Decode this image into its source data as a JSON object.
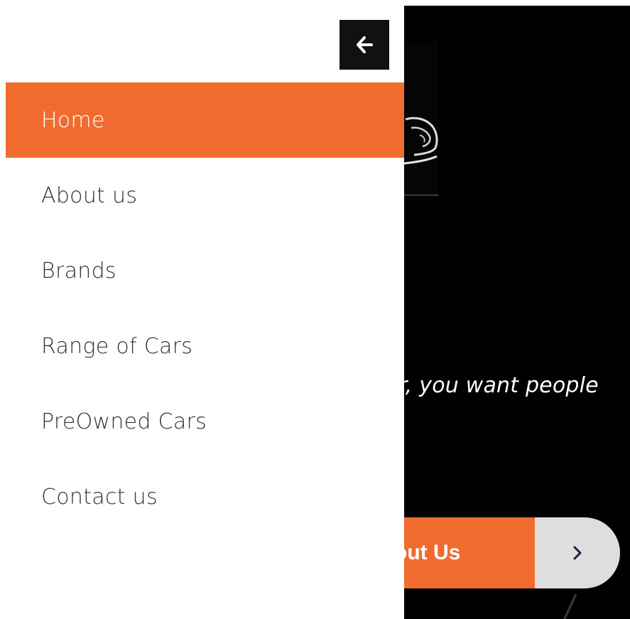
{
  "colors": {
    "accent": "#f26b2e",
    "drawer_bg": "#ffffff",
    "close_button_bg": "#111111",
    "nav_text": "#333333",
    "hero_bg": "#000000",
    "arrow_button_bg": "#dedede"
  },
  "drawer": {
    "close_icon": "arrow-left-icon",
    "nav_items": [
      {
        "label": "Home",
        "active": true
      },
      {
        "label": "About us",
        "active": false
      },
      {
        "label": "Brands",
        "active": false
      },
      {
        "label": "Range of Cars",
        "active": false
      },
      {
        "label": "PreOwned Cars",
        "active": false
      },
      {
        "label": "Contact us",
        "active": false
      }
    ]
  },
  "hero": {
    "logo_icon": "car-logo-icon",
    "tagline": "r, you want people",
    "cta_label": "out Us",
    "cta_arrow_icon": "chevron-right-icon"
  }
}
